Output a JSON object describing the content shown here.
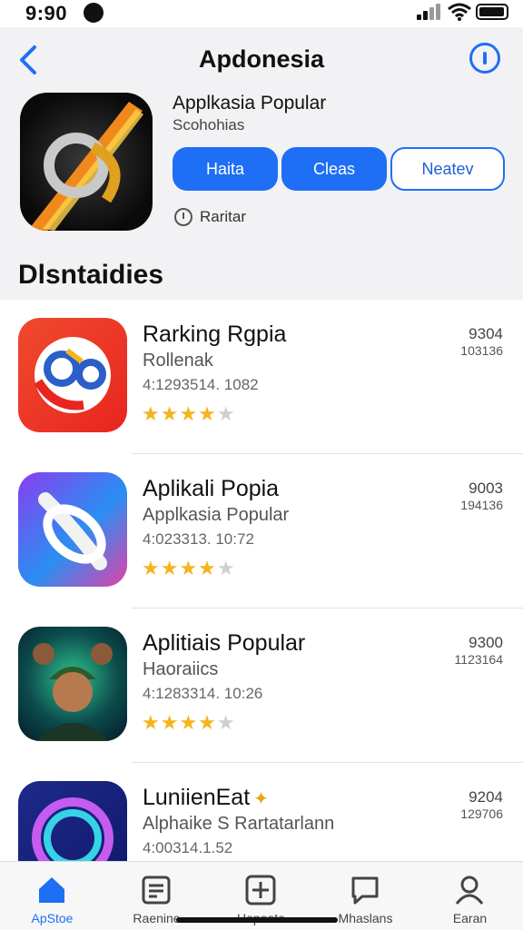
{
  "status_bar": {
    "time": "9:90"
  },
  "nav": {
    "title": "Apdonesia"
  },
  "hero": {
    "title": "Applkasia Popular",
    "subtitle": "Scohohias",
    "buttons": [
      "Haita",
      "Cleas",
      "Neatev"
    ],
    "rank_label": "Raritar"
  },
  "section": {
    "title": "Dlsntaidies"
  },
  "apps": [
    {
      "name": "Rarking Rgpia",
      "sub": "Rollenak",
      "meta": "4:1293514. 1082",
      "rating": 4,
      "price": "9304",
      "count": "103136",
      "sparkle": ""
    },
    {
      "name": "Aplikali Popia",
      "sub": "Applkasia Popular",
      "meta": "4:023313. 10:72",
      "rating": 4,
      "price": "9003",
      "count": "194136",
      "sparkle": ""
    },
    {
      "name": "Aplitiais Popular",
      "sub": "Haoraiics",
      "meta": "4:1283314. 10:26",
      "rating": 4,
      "price": "9300",
      "count": "1123164",
      "sparkle": ""
    },
    {
      "name": "LuniienEat",
      "sub": "Alphaike S Rartatarlann",
      "meta": "4:00314.1.52",
      "rating": 4,
      "price": "9204",
      "count": "129706",
      "sparkle": "✦"
    }
  ],
  "tabs": [
    {
      "label": "ApStoe",
      "icon": "home-icon",
      "active": true
    },
    {
      "label": "Raenine",
      "icon": "ranking-icon",
      "active": false
    },
    {
      "label": "Hopoato",
      "icon": "add-square-icon",
      "active": false
    },
    {
      "label": "Mhaslans",
      "icon": "chat-icon",
      "active": false
    },
    {
      "label": "Earan",
      "icon": "person-icon",
      "active": false
    }
  ],
  "colors": {
    "accent": "#1e6ff5",
    "star": "#f5b41e"
  }
}
